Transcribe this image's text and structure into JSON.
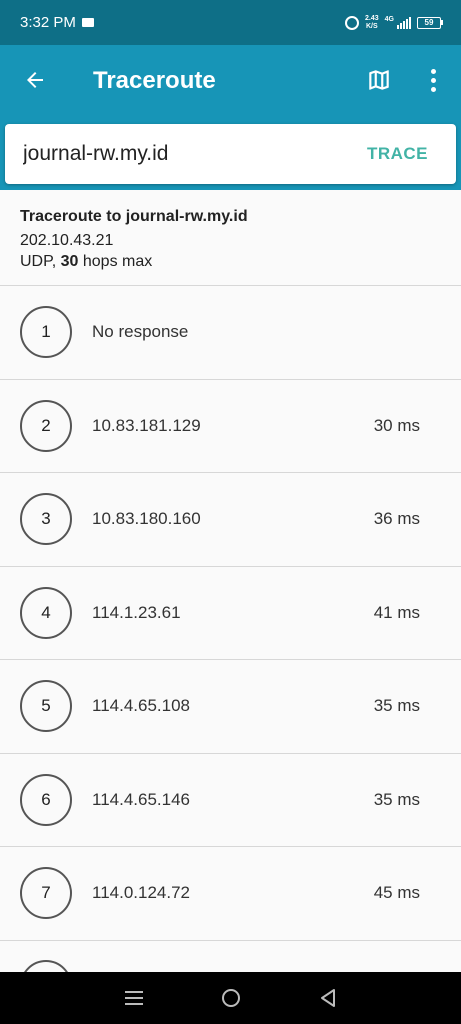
{
  "status_bar": {
    "time": "3:32 PM",
    "net_speed_value": "2.43",
    "net_speed_unit": "K/S",
    "network_type": "4G",
    "battery_level": "59"
  },
  "app_bar": {
    "title": "Traceroute"
  },
  "search": {
    "host_value": "journal-rw.my.id",
    "trace_label": "TRACE"
  },
  "summary": {
    "title": "Traceroute to journal-rw.my.id",
    "ip": "202.10.43.21",
    "protocol": "UDP,",
    "max_hops": "30",
    "hops_suffix": "hops max"
  },
  "hops": [
    {
      "num": "1",
      "address": "No response",
      "time": ""
    },
    {
      "num": "2",
      "address": "10.83.181.129",
      "time": "30 ms"
    },
    {
      "num": "3",
      "address": "10.83.180.160",
      "time": "36 ms"
    },
    {
      "num": "4",
      "address": "114.1.23.61",
      "time": "41 ms"
    },
    {
      "num": "5",
      "address": "114.4.65.108",
      "time": "35 ms"
    },
    {
      "num": "6",
      "address": "114.4.65.146",
      "time": "35 ms"
    },
    {
      "num": "7",
      "address": "114.0.124.72",
      "time": "45 ms"
    }
  ],
  "colors": {
    "status_bar": "#0e6f87",
    "app_bar": "#1795b7",
    "trace_accent": "#42b3a6"
  },
  "icons": {
    "back": "arrow-left-icon",
    "map": "map-icon",
    "more": "more-vert-icon",
    "nav_menu": "menu-icon",
    "nav_home": "home-icon",
    "nav_back": "triangle-back-icon"
  }
}
